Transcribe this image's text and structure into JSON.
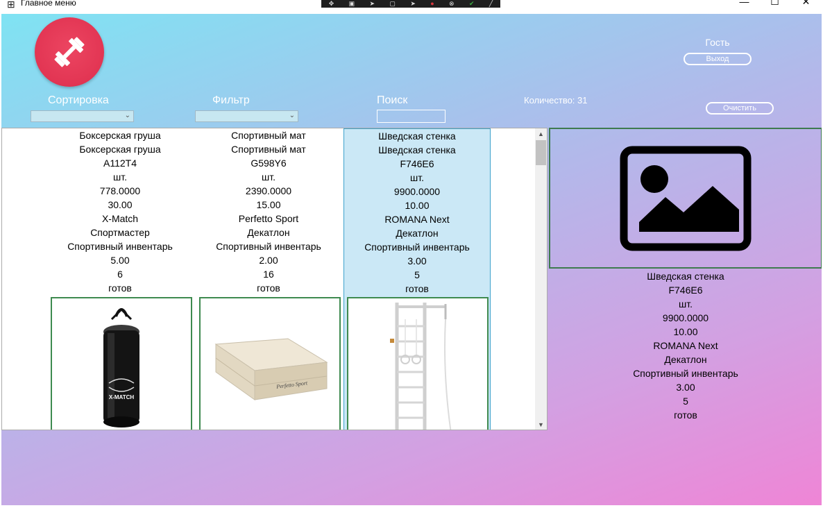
{
  "window": {
    "title": "Главное меню",
    "minimize": "—",
    "maximize": "☐",
    "close": "✕"
  },
  "user": {
    "name": "Гость",
    "exit_label": "Выход"
  },
  "controls": {
    "sort_label": "Сортировка",
    "filter_label": "Фильтр",
    "search_label": "Поиск",
    "search_value": "",
    "count_text": "Количество: 31",
    "clear_label": "Очистить"
  },
  "products": [
    {
      "name": "Боксерская груша",
      "category_name": "Боксерская груша",
      "article": "A112T4",
      "unit": "шт.",
      "price": "778.0000",
      "discount_max": "30.00",
      "manufacturer": "X-Match",
      "supplier": "Спортмастер",
      "category": "Спортивный инвентарь",
      "discount": "5.00",
      "quantity": "6",
      "status": "готов",
      "image": "punching-bag"
    },
    {
      "name": "Спортивный мат",
      "category_name": "Спортивный мат",
      "article": "G598Y6",
      "unit": "шт.",
      "price": "2390.0000",
      "discount_max": "15.00",
      "manufacturer": "Perfetto Sport",
      "supplier": "Декатлон",
      "category": "Спортивный инвентарь",
      "discount": "2.00",
      "quantity": "16",
      "status": "готов",
      "image": "sport-mat"
    },
    {
      "name": "Шведская стенка",
      "category_name": "Шведская стенка",
      "article": "F746E6",
      "unit": "шт.",
      "price": "9900.0000",
      "discount_max": "10.00",
      "manufacturer": "ROMANA Next",
      "supplier": "Декатлон",
      "category": "Спортивный инвентарь",
      "discount": "3.00",
      "quantity": "5",
      "status": "готов",
      "image": "wall-bars"
    }
  ],
  "selected": {
    "name": "Шведская стенка",
    "article": "F746E6",
    "unit": "шт.",
    "price": "9900.0000",
    "discount_max": "10.00",
    "manufacturer": "ROMANA Next",
    "supplier": "Декатлон",
    "category": "Спортивный инвентарь",
    "discount": "3.00",
    "quantity": "5",
    "status": "готов",
    "image": "image-placeholder-icon"
  },
  "product_image_labels": {
    "bag_brand": "X-MATCH",
    "mat_brand": "Perfetto Sport"
  },
  "colors": {
    "logo": "#e23553",
    "frame": "#3e8a4f",
    "selection": "#cbe8f6"
  }
}
